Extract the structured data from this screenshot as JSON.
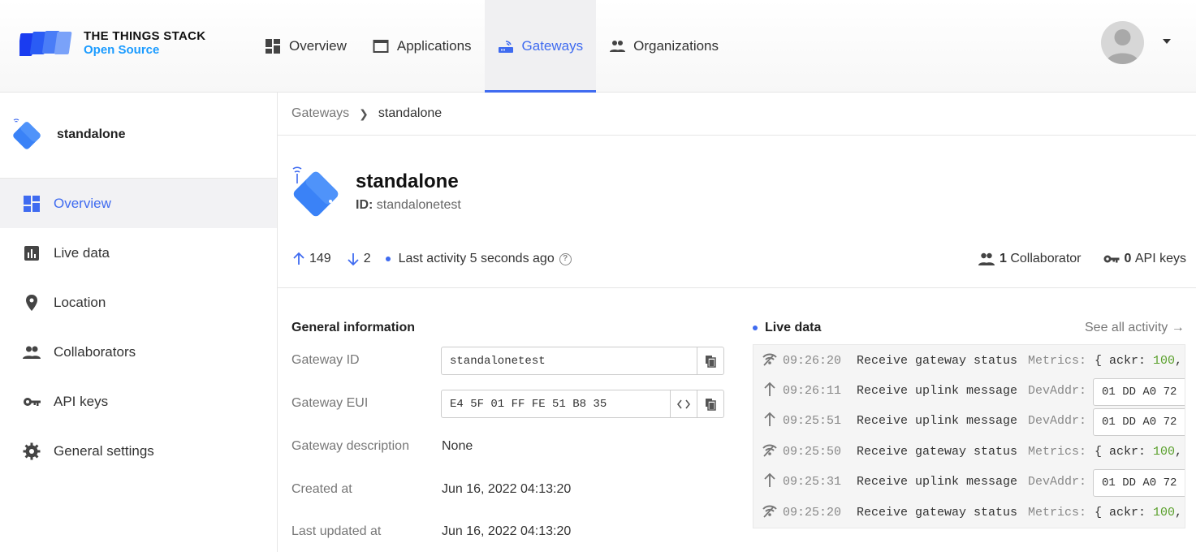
{
  "brand": {
    "title": "THE THINGS STACK",
    "subtitle": "Open Source"
  },
  "nav": [
    {
      "label": "Overview",
      "icon": "dashboard-icon"
    },
    {
      "label": "Applications",
      "icon": "window-icon"
    },
    {
      "label": "Gateways",
      "icon": "router-icon",
      "active": true
    },
    {
      "label": "Organizations",
      "icon": "people-icon"
    }
  ],
  "sidebar": {
    "gateway_name": "standalone",
    "items": [
      {
        "label": "Overview",
        "icon": "dashboard-icon",
        "active": true
      },
      {
        "label": "Live data",
        "icon": "chart-icon"
      },
      {
        "label": "Location",
        "icon": "location-pin-icon"
      },
      {
        "label": "Collaborators",
        "icon": "people-icon"
      },
      {
        "label": "API keys",
        "icon": "key-icon"
      },
      {
        "label": "General settings",
        "icon": "gear-icon"
      }
    ]
  },
  "breadcrumb": {
    "parent": "Gateways",
    "current": "standalone"
  },
  "gateway": {
    "name": "standalone",
    "id_label": "ID:",
    "id": "standalonetest",
    "uplink_count": "149",
    "downlink_count": "2",
    "last_activity": "Last activity 5 seconds ago",
    "collaborators_count": "1",
    "collaborators_label": "Collaborator",
    "api_keys_count": "0",
    "api_keys_label": "API keys"
  },
  "general": {
    "title": "General information",
    "gateway_id_label": "Gateway ID",
    "gateway_id": "standalonetest",
    "gateway_eui_label": "Gateway EUI",
    "gateway_eui": "E4 5F 01 FF FE 51 B8 35",
    "description_label": "Gateway description",
    "description": "None",
    "created_label": "Created at",
    "created": "Jun 16, 2022 04:13:20",
    "updated_label": "Last updated at",
    "updated": "Jun 16, 2022 04:13:20"
  },
  "live": {
    "title": "Live data",
    "see_all": "See all activity →",
    "events": [
      {
        "time": "09:26:20",
        "msg": "Receive gateway status",
        "key": "Metrics:",
        "value_prefix": "{ ackr: ",
        "value_num": "100",
        "value_suffix": ",",
        "kind": "status"
      },
      {
        "time": "09:26:11",
        "msg": "Receive uplink message",
        "key": "DevAddr:",
        "value": "01 DD A0 72",
        "kind": "uplink"
      },
      {
        "time": "09:25:51",
        "msg": "Receive uplink message",
        "key": "DevAddr:",
        "value": "01 DD A0 72",
        "kind": "uplink"
      },
      {
        "time": "09:25:50",
        "msg": "Receive gateway status",
        "key": "Metrics:",
        "value_prefix": "{ ackr: ",
        "value_num": "100",
        "value_suffix": ",",
        "kind": "status"
      },
      {
        "time": "09:25:31",
        "msg": "Receive uplink message",
        "key": "DevAddr:",
        "value": "01 DD A0 72",
        "kind": "uplink"
      },
      {
        "time": "09:25:20",
        "msg": "Receive gateway status",
        "key": "Metrics:",
        "value_prefix": "{ ackr: ",
        "value_num": "100",
        "value_suffix": ",",
        "kind": "status"
      }
    ]
  },
  "colors": {
    "accent": "#3f6bf0",
    "brand_blue": "#1a9bff",
    "number_green": "#5aa02c"
  }
}
